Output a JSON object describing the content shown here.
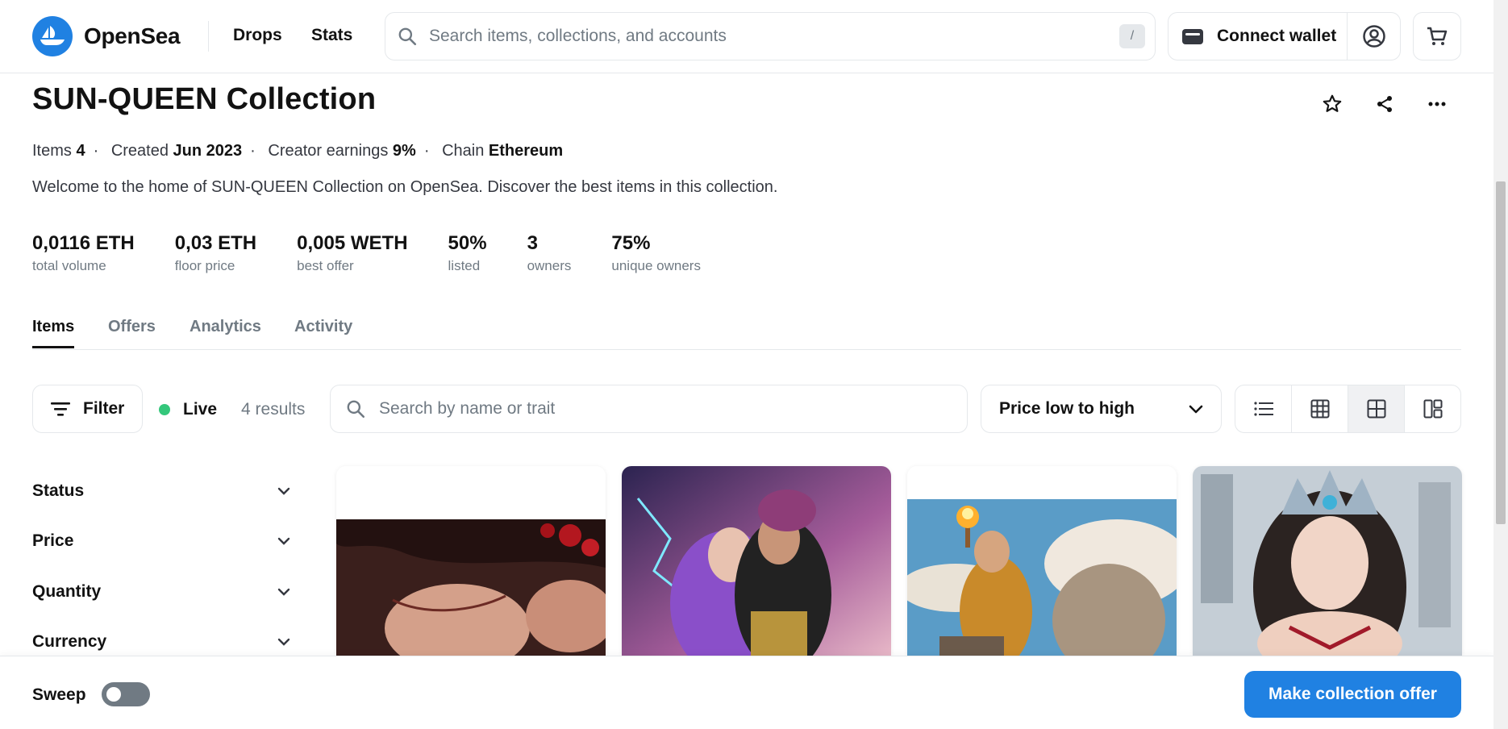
{
  "header": {
    "logo_text": "OpenSea",
    "nav": [
      "Drops",
      "Stats"
    ],
    "search_placeholder": "Search items, collections, and accounts",
    "search_shortcut": "/",
    "connect_wallet": "Connect wallet"
  },
  "collection": {
    "title": "SUN-QUEEN Collection",
    "meta": {
      "items_label": "Items",
      "items_value": "4",
      "created_label": "Created",
      "created_value": "Jun 2023",
      "earnings_label": "Creator earnings",
      "earnings_value": "9%",
      "chain_label": "Chain",
      "chain_value": "Ethereum"
    },
    "description": "Welcome to the home of SUN-QUEEN Collection on OpenSea. Discover the best items in this collection.",
    "stats": [
      {
        "value": "0,0116 ETH",
        "label": "total volume"
      },
      {
        "value": "0,03 ETH",
        "label": "floor price"
      },
      {
        "value": "0,005 WETH",
        "label": "best offer"
      },
      {
        "value": "50%",
        "label": "listed"
      },
      {
        "value": "3",
        "label": "owners"
      },
      {
        "value": "75%",
        "label": "unique owners"
      }
    ]
  },
  "tabs": [
    "Items",
    "Offers",
    "Analytics",
    "Activity"
  ],
  "toolbar": {
    "filter_label": "Filter",
    "live_label": "Live",
    "results": "4 results",
    "item_search_placeholder": "Search by name or trait",
    "sort_value": "Price low to high"
  },
  "sidebar": [
    "Status",
    "Price",
    "Quantity",
    "Currency"
  ],
  "bottom": {
    "sweep_label": "Sweep",
    "offer_button": "Make collection offer"
  },
  "colors": {
    "accent": "#2081e2",
    "live": "#34c77b"
  }
}
